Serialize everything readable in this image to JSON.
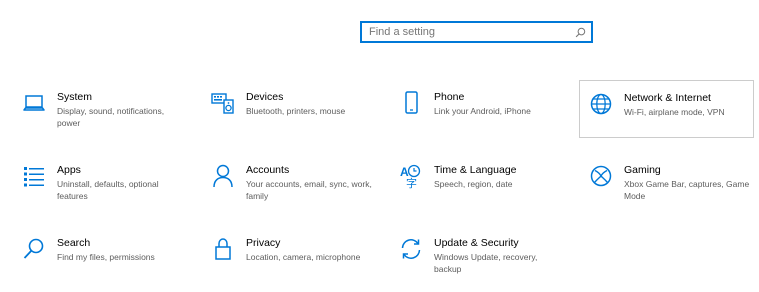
{
  "search": {
    "placeholder": "Find a setting",
    "icon": "search-icon"
  },
  "accent": "#0078d7",
  "tiles": [
    {
      "title": "System",
      "desc": "Display, sound, notifications, power",
      "icon": "laptop-icon"
    },
    {
      "title": "Devices",
      "desc": "Bluetooth, printers, mouse",
      "icon": "keyboard-speaker-icon"
    },
    {
      "title": "Phone",
      "desc": "Link your Android, iPhone",
      "icon": "phone-icon"
    },
    {
      "title": "Network & Internet",
      "desc": "Wi-Fi, airplane mode, VPN",
      "icon": "globe-icon"
    },
    {
      "title": "Apps",
      "desc": "Uninstall, defaults, optional features",
      "icon": "apps-list-icon"
    },
    {
      "title": "Accounts",
      "desc": "Your accounts, email, sync, work, family",
      "icon": "person-icon"
    },
    {
      "title": "Time & Language",
      "desc": "Speech, region, date",
      "icon": "time-language-icon"
    },
    {
      "title": "Gaming",
      "desc": "Xbox Game Bar, captures, Game Mode",
      "icon": "xbox-icon"
    },
    {
      "title": "Search",
      "desc": "Find my files, permissions",
      "icon": "search-icon"
    },
    {
      "title": "Privacy",
      "desc": "Location, camera, microphone",
      "icon": "lock-icon"
    },
    {
      "title": "Update & Security",
      "desc": "Windows Update, recovery, backup",
      "icon": "update-icon"
    }
  ]
}
